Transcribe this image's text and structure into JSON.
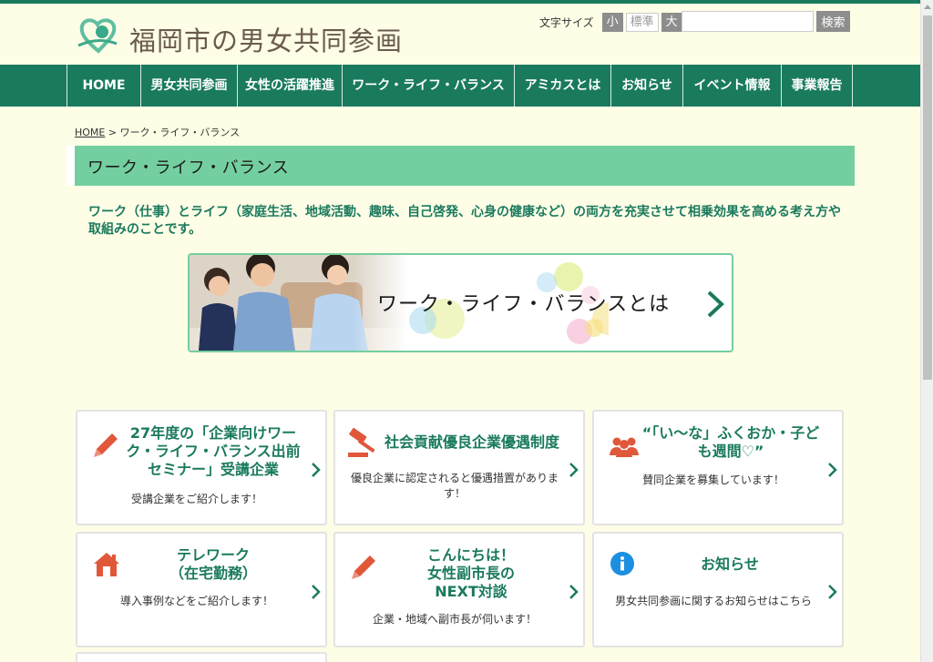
{
  "header": {
    "logo_text": "福岡市の男女共同参画",
    "font_size_label": "文字サイズ",
    "font_small": "小",
    "font_standard": "標準",
    "font_large": "大",
    "search_placeholder": "",
    "search_button": "検索"
  },
  "nav": {
    "items": [
      {
        "label": "HOME"
      },
      {
        "label": "男女共同参画"
      },
      {
        "label": "女性の活躍推進"
      },
      {
        "label": "ワーク・ライフ・バランス"
      },
      {
        "label": "アミカスとは"
      },
      {
        "label": "お知らせ"
      },
      {
        "label": "イベント情報"
      },
      {
        "label": "事業報告"
      }
    ]
  },
  "breadcrumb": {
    "home": "HOME",
    "separator": " > ",
    "current": "ワーク・ライフ・バランス"
  },
  "page": {
    "title": "ワーク・ライフ・バランス",
    "lead": "ワーク（仕事）とライフ（家庭生活、地域活動、趣味、自己啓発、心身の健康など）の両方を充実させて相乗効果を高める考え方や取組みのことです。"
  },
  "banner": {
    "text": "ワーク・ライフ・バランスとは"
  },
  "cards": [
    {
      "icon": "pencil-icon",
      "title": "27年度の「企業向けワーク・ライフ・バランス出前セミナー」受講企業",
      "desc": "受講企業をご紹介します！"
    },
    {
      "icon": "gavel-icon",
      "title": "社会貢献優良企業優遇制度",
      "desc": "優良企業に認定されると優遇措置があります！"
    },
    {
      "icon": "people-icon",
      "title": "“「い～な」ふくおか・子ども週間♡”",
      "desc": "賛同企業を募集しています！"
    },
    {
      "icon": "house-icon",
      "title": "テレワーク\n（在宅勤務）",
      "desc": "導入事例などをご紹介します！"
    },
    {
      "icon": "pencil-icon",
      "title": "こんにちは！\n女性副市長の\nNEXT対談",
      "desc": "企業・地域へ副市長が伺います！"
    },
    {
      "icon": "info-icon",
      "title": "お知らせ",
      "desc": "男女共同参画に関するお知らせはこちら"
    }
  ],
  "colors": {
    "primary_green": "#1a7a5e",
    "title_band": "#74cfa0",
    "icon_orange": "#e0573a",
    "info_blue": "#1d8fe0",
    "background": "#fefde6"
  }
}
